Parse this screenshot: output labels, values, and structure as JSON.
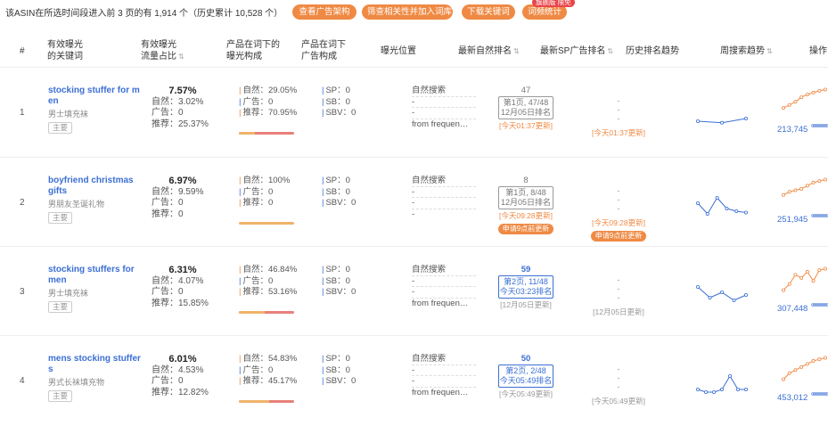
{
  "summary": "该ASIN在所选时间段进入前 3 页的有 1,914 个（历史累计 10,528 个）",
  "actions": {
    "ad_structure": "查看广告架构",
    "filter_add": "筛查相关性并加入词库",
    "download": "下载关键词",
    "word_freq": "词频统计",
    "badge": "旗舰版 限免"
  },
  "headers": {
    "idx": "#",
    "keyword_l1": "有效曝光",
    "keyword_l2": "的关键词",
    "share_l1": "有效曝光",
    "share_l2": "流量占比",
    "comp_l1": "产品在词下的",
    "comp_l2": "曝光构成",
    "ad_l1": "产品在词下",
    "ad_l2": "广告构成",
    "position": "曝光位置",
    "organic_rank": "最新自然排名",
    "sp_rank": "最新SP广告排名",
    "history": "历史排名趋势",
    "weekly": "周搜索趋势",
    "ops": "操作"
  },
  "colors": {
    "accent": "#ef8a44",
    "link": "#3b6fd4",
    "organic_bar": "#f0b36a",
    "rec_bar": "#e8807a"
  },
  "rows": [
    {
      "idx": "1",
      "keyword": "stocking stuffer for men",
      "keyword_cn": "男士填充袜",
      "tag": "主要",
      "share_pct": "7.57%",
      "share_natural": "自然：3.02%",
      "share_ad": "广告：0",
      "share_rec": "推荐：25.37%",
      "comp_natural": "自然：29.05%",
      "comp_ad": "广告：0",
      "comp_rec": "推荐：70.95%",
      "comp_natural_frac": 0.29,
      "ad_sp": "SP：0",
      "ad_sb": "SB：0",
      "ad_sbv": "SBV：0",
      "pos_1": "自然搜索",
      "pos_2": "-",
      "pos_3": "-",
      "pos_4": "from frequen…",
      "rank_num": "47",
      "rank_page": "第1页, 47/48",
      "rank_date": "12月05日排名",
      "rank_upd": "[今天01:37更新]",
      "rank_req": "",
      "sp_rank": "-",
      "sp_upd": "[今天01:37更新]",
      "sp_req": "",
      "op_num": "213,745",
      "history_trend": [
        3,
        2.4,
        4
      ],
      "weekly_trend": [
        4,
        5,
        6,
        7.5,
        8.4,
        9,
        9.6,
        10
      ]
    },
    {
      "idx": "2",
      "keyword": "boyfriend christmas gifts",
      "keyword_cn": "男朋友圣诞礼物",
      "tag": "主要",
      "share_pct": "6.97%",
      "share_natural": "自然：9.59%",
      "share_ad": "广告：0",
      "share_rec": "推荐：0",
      "comp_natural": "自然：100%",
      "comp_ad": "广告：0",
      "comp_rec": "推荐：0",
      "comp_natural_frac": 1.0,
      "ad_sp": "SP：0",
      "ad_sb": "SB：0",
      "ad_sbv": "SBV：0",
      "pos_1": "自然搜索",
      "pos_2": "-",
      "pos_3": "-",
      "pos_4": "-",
      "rank_num": "8",
      "rank_page": "第1页, 8/48",
      "rank_date": "12月05日排名",
      "rank_upd": "[今天09:28更新]",
      "rank_req": "申请9点前更新",
      "sp_rank": "-",
      "sp_upd": "[今天09:28更新]",
      "sp_req": "申请9点前更新",
      "op_num": "251,945",
      "history_trend": [
        6,
        2,
        8,
        4,
        3,
        2.5
      ],
      "weekly_trend": [
        5,
        6,
        6.5,
        7,
        8,
        9,
        9.5,
        10
      ]
    },
    {
      "idx": "3",
      "keyword": "stocking stuffers for men",
      "keyword_cn": "男士填充袜",
      "tag": "主要",
      "share_pct": "6.31%",
      "share_natural": "自然：4.07%",
      "share_ad": "广告：0",
      "share_rec": "推荐：15.85%",
      "comp_natural": "自然：46.84%",
      "comp_ad": "广告：0",
      "comp_rec": "推荐：53.16%",
      "comp_natural_frac": 0.47,
      "ad_sp": "SP：0",
      "ad_sb": "SB：0",
      "ad_sbv": "SBV：0",
      "pos_1": "自然搜索",
      "pos_2": "-",
      "pos_3": "-",
      "pos_4": "from frequen…",
      "rank_num": "59",
      "rank_page": "第2页, 11/48",
      "rank_date": "今天03:23排名",
      "rank_upd": "[12月05日更新]",
      "rank_req": "",
      "sp_rank": "-",
      "sp_upd": "[12月05日更新]",
      "sp_req": "",
      "op_num": "307,448",
      "history_trend": [
        8,
        4,
        6,
        3,
        5
      ],
      "weekly_trend": [
        3,
        5,
        8,
        7,
        9,
        6,
        9.5,
        10
      ]
    },
    {
      "idx": "4",
      "keyword": "mens stocking stuffers",
      "keyword_cn": "男式长袜填充物",
      "tag": "主要",
      "share_pct": "6.01%",
      "share_natural": "自然：4.53%",
      "share_ad": "广告：0",
      "share_rec": "推荐：12.82%",
      "comp_natural": "自然：54.83%",
      "comp_ad": "广告：0",
      "comp_rec": "推荐：45.17%",
      "comp_natural_frac": 0.55,
      "ad_sp": "SP：0",
      "ad_sb": "SB：0",
      "ad_sbv": "SBV：0",
      "pos_1": "自然搜索",
      "pos_2": "-",
      "pos_3": "-",
      "pos_4": "from frequen…",
      "rank_num": "50",
      "rank_page": "第2页, 2/48",
      "rank_date": "今天05:49排名",
      "rank_upd": "[今天05:49更新]",
      "rank_req": "",
      "sp_rank": "-",
      "sp_upd": "[今天05:49更新]",
      "sp_req": "",
      "op_num": "453,012",
      "history_trend": [
        3,
        2,
        2,
        3,
        8,
        3,
        3
      ],
      "weekly_trend": [
        3,
        5,
        6,
        7,
        8,
        9,
        9.5,
        10
      ]
    }
  ]
}
